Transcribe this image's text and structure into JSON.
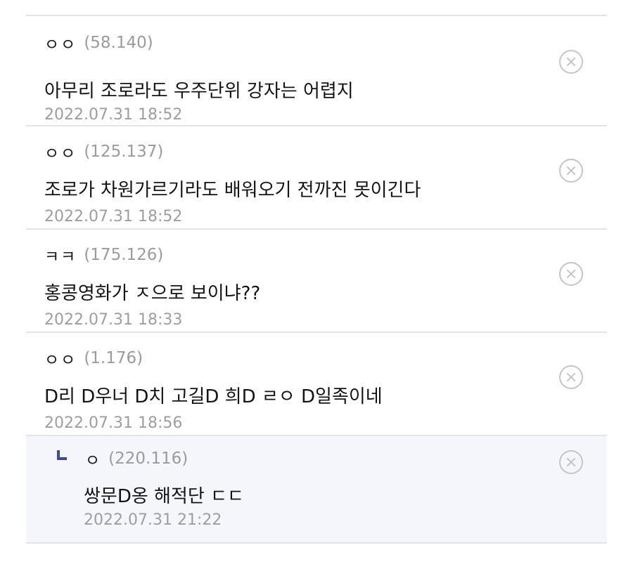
{
  "comments": [
    {
      "nickname": "ㅇㅇ",
      "ip": "(58.140)",
      "text": "아무리 조로라도 우주단위 강자는 어렵지",
      "date": "2022.07.31 18:52"
    },
    {
      "nickname": "ㅇㅇ",
      "ip": "(125.137)",
      "text": "조로가 차원가르기라도 배워오기 전까진 못이긴다",
      "date": "2022.07.31 18:52"
    },
    {
      "nickname": "ㅋㅋ",
      "ip": "(175.126)",
      "text": "홍콩영화가 ㅈ으로 보이냐??",
      "date": "2022.07.31 18:33"
    },
    {
      "nickname": "ㅇㅇ",
      "ip": "(1.176)",
      "text": "D리 D우너 D치 고길D 희D ㄹㅇ D일족이네",
      "date": "2022.07.31 18:56"
    }
  ],
  "reply": {
    "nickname": "ㅇ",
    "ip": "(220.116)",
    "text": "쌍문D옹 해적단 ㄷㄷ",
    "date": "2022.07.31 21:22"
  }
}
